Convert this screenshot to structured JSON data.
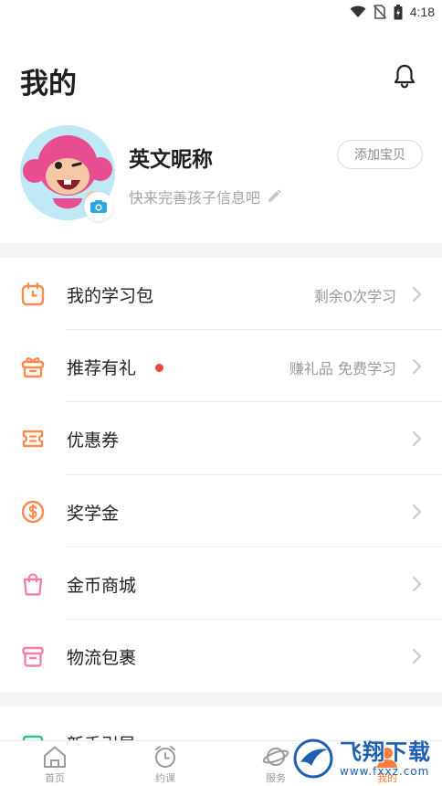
{
  "status_bar": {
    "time": "4:18"
  },
  "header": {
    "title": "我的"
  },
  "profile": {
    "nickname": "英文昵称",
    "subtitle": "快来完善孩子信息吧",
    "add_baby_label": "添加宝贝"
  },
  "menu": {
    "items": [
      {
        "label": "我的学习包",
        "value": "剩余0次学习",
        "icon": "calendar-icon"
      },
      {
        "label": "推荐有礼",
        "value": "赚礼品 免费学习",
        "icon": "gift-icon",
        "badge": "red-dot"
      },
      {
        "label": "优惠券",
        "value": "",
        "icon": "coupon-icon"
      },
      {
        "label": "奖学金",
        "value": "",
        "icon": "dollar-coin-icon"
      },
      {
        "label": "金币商城",
        "value": "",
        "icon": "shopping-bag-icon"
      },
      {
        "label": "物流包裹",
        "value": "",
        "icon": "package-icon"
      }
    ],
    "partial_item": {
      "label": "新手引导",
      "icon": "guide-icon"
    }
  },
  "tabbar": {
    "tabs": [
      {
        "label": "首页",
        "icon": "home-icon",
        "active": false
      },
      {
        "label": "约课",
        "icon": "alarm-clock-icon",
        "active": false
      },
      {
        "label": "服务",
        "icon": "planet-icon",
        "active": false
      },
      {
        "label": "我的",
        "icon": "user-icon",
        "active": true
      }
    ]
  },
  "watermark": {
    "title": "飞翔下载",
    "url": "www.fxxz.com"
  },
  "colors": {
    "accent_orange": "#ff8a4c",
    "pink": "#f57fa8",
    "red_dot": "#f0453a",
    "camera_blue": "#29a8e0",
    "avatar_bg": "#bfe9f5"
  }
}
